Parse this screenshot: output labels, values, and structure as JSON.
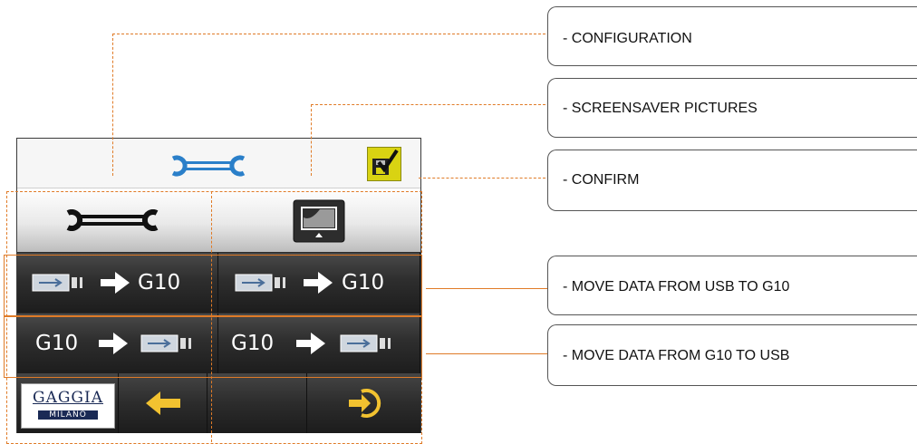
{
  "screen": {
    "footer": {
      "logo_brand": "GAGGIA",
      "logo_sub": "MILANO"
    },
    "rows": [
      {
        "cells": [
          {
            "label": "G10"
          },
          {
            "label": "G10"
          }
        ]
      },
      {
        "cells": [
          {
            "label": "G10"
          },
          {
            "label": "G10"
          }
        ]
      }
    ]
  },
  "callouts": [
    {
      "label": "-  CONFIGURATION"
    },
    {
      "label": "-  SCREENSAVER PICTURES"
    },
    {
      "label": "-  CONFIRM"
    },
    {
      "label": "-  MOVE DATA FROM USB TO G10"
    },
    {
      "label": "-  MOVE DATA FROM G10 TO USB"
    }
  ],
  "colors": {
    "accent": "#e07b27",
    "icon_blue": "#2a7fc9",
    "confirm_yellow": "#d9d312",
    "arrow_yellow": "#f2c230"
  },
  "icons": [
    "wrench-icon",
    "screensaver-monitor-icon",
    "confirm-save-icon",
    "usb-stick-icon",
    "right-arrow-icon",
    "back-arrow-icon",
    "enter-icon"
  ]
}
